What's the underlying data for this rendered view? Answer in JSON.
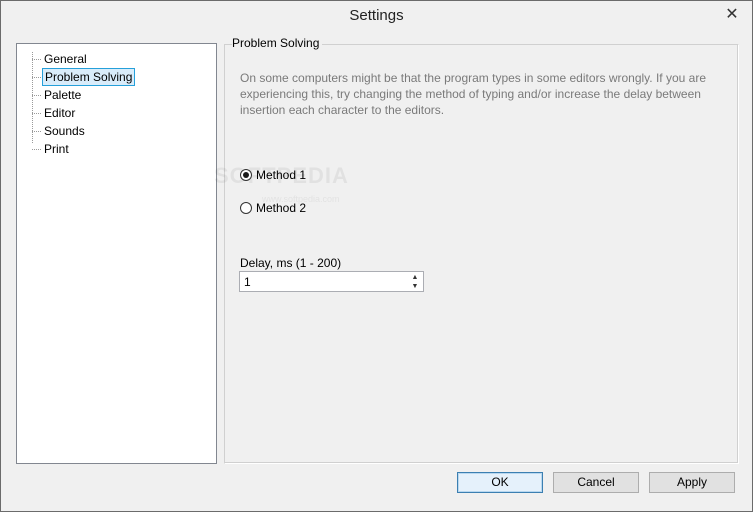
{
  "window": {
    "title": "Settings"
  },
  "tree": {
    "items": [
      {
        "label": "General",
        "selected": false
      },
      {
        "label": "Problem Solving",
        "selected": true
      },
      {
        "label": "Palette",
        "selected": false
      },
      {
        "label": "Editor",
        "selected": false
      },
      {
        "label": "Sounds",
        "selected": false
      },
      {
        "label": "Print",
        "selected": false
      }
    ]
  },
  "panel": {
    "title": "Problem Solving",
    "description": "On some computers might be that the program types in some editors wrongly. If you are experiencing this, try changing the method of typing and/or increase the delay between insertion each character to the editors.",
    "methods": [
      {
        "label": "Method 1",
        "checked": true
      },
      {
        "label": "Method 2",
        "checked": false
      }
    ],
    "delay_label": "Delay, ms (1 - 200)",
    "delay_value": "1"
  },
  "watermark": {
    "text": "SOFTPEDIA",
    "sub": "www.softpedia.com"
  },
  "buttons": {
    "ok": "OK",
    "cancel": "Cancel",
    "apply": "Apply"
  },
  "icons": {
    "close": "close-icon",
    "spin_up": "chevron-up-icon",
    "spin_down": "chevron-down-icon"
  },
  "colors": {
    "selection_border": "#26a0da",
    "selection_fill": "#d9ecfa",
    "description_text": "#7a7a7a"
  }
}
